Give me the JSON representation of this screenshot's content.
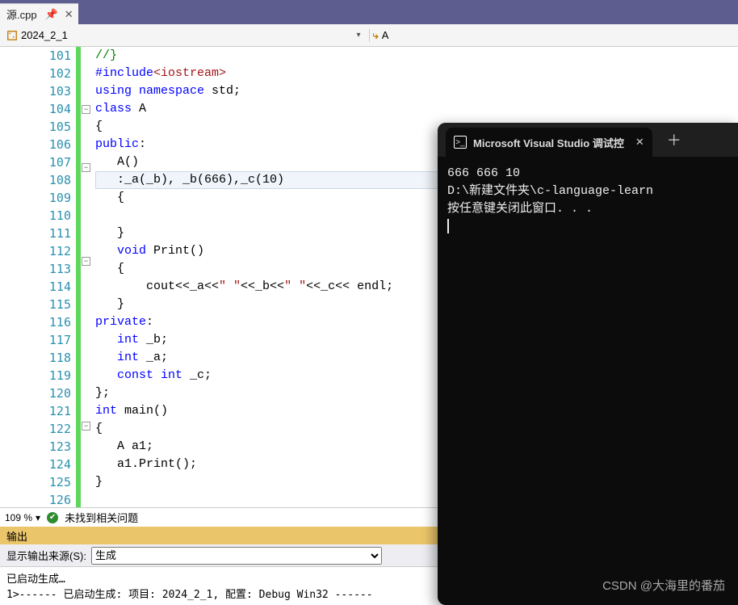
{
  "tab": {
    "label": "源.cpp"
  },
  "selectors": {
    "left": "2024_2_1",
    "right": "A"
  },
  "line_start": 101,
  "code_lines": [
    {
      "fold": "",
      "tokens": [
        {
          "t": "punct",
          "v": "|"
        },
        {
          "t": "comment",
          "v": "//}"
        }
      ]
    },
    {
      "fold": "",
      "tokens": [
        {
          "t": "punct",
          "v": "|"
        },
        {
          "t": "keyword",
          "v": "#include"
        },
        {
          "t": "lib",
          "v": "<iostream>"
        }
      ]
    },
    {
      "fold": "",
      "tokens": [
        {
          "t": "punct",
          "v": "|"
        },
        {
          "t": "keyword",
          "v": "using namespace"
        },
        {
          "t": "normal",
          "v": " std"
        },
        {
          "t": "semicl",
          "v": ";"
        }
      ]
    },
    {
      "fold": "⊟",
      "tokens": [
        {
          "t": "keyword",
          "v": "class"
        },
        {
          "t": "normal",
          "v": " A"
        }
      ]
    },
    {
      "fold": "",
      "tokens": [
        {
          "t": "punct",
          "v": "|{"
        }
      ]
    },
    {
      "fold": "",
      "tokens": [
        {
          "t": "punct",
          "v": "|"
        },
        {
          "t": "keyword",
          "v": "public"
        },
        {
          "t": "punct",
          "v": ":"
        }
      ]
    },
    {
      "fold": "⊟",
      "tokens": [
        {
          "t": "punct",
          "v": "|   "
        },
        {
          "t": "normal",
          "v": "A()"
        }
      ]
    },
    {
      "fold": "",
      "highlight": true,
      "tokens": [
        {
          "t": "punct",
          "v": "|   "
        },
        {
          "t": "normal",
          "v": ":_a(_b), _b(666),_c(10)"
        }
      ]
    },
    {
      "fold": "",
      "tokens": [
        {
          "t": "punct",
          "v": "|   {"
        }
      ]
    },
    {
      "fold": "",
      "tokens": [
        {
          "t": "punct",
          "v": "|"
        }
      ]
    },
    {
      "fold": "",
      "tokens": [
        {
          "t": "punct",
          "v": "|   }"
        }
      ]
    },
    {
      "fold": "⊟",
      "tokens": [
        {
          "t": "punct",
          "v": "|   "
        },
        {
          "t": "keyword",
          "v": "void"
        },
        {
          "t": "normal",
          "v": " Print()"
        }
      ]
    },
    {
      "fold": "",
      "tokens": [
        {
          "t": "punct",
          "v": "|   {"
        }
      ]
    },
    {
      "fold": "",
      "tokens": [
        {
          "t": "punct",
          "v": "|       "
        },
        {
          "t": "normal",
          "v": "cout<<_a<<"
        },
        {
          "t": "string",
          "v": "\" \""
        },
        {
          "t": "normal",
          "v": "<<_b<<"
        },
        {
          "t": "string",
          "v": "\" \""
        },
        {
          "t": "normal",
          "v": "<<_c<< endl"
        },
        {
          "t": "semicl",
          "v": ";"
        }
      ]
    },
    {
      "fold": "",
      "tokens": [
        {
          "t": "punct",
          "v": "|   }"
        }
      ]
    },
    {
      "fold": "",
      "tokens": [
        {
          "t": "punct",
          "v": "|"
        },
        {
          "t": "keyword",
          "v": "private"
        },
        {
          "t": "punct",
          "v": ":"
        }
      ]
    },
    {
      "fold": "",
      "tokens": [
        {
          "t": "punct",
          "v": "|   "
        },
        {
          "t": "keyword",
          "v": "int"
        },
        {
          "t": "normal",
          "v": " _b"
        },
        {
          "t": "semicl",
          "v": ";"
        }
      ]
    },
    {
      "fold": "",
      "tokens": [
        {
          "t": "punct",
          "v": "|   "
        },
        {
          "t": "keyword",
          "v": "int"
        },
        {
          "t": "normal",
          "v": " _a"
        },
        {
          "t": "semicl",
          "v": ";"
        }
      ]
    },
    {
      "fold": "",
      "tokens": [
        {
          "t": "punct",
          "v": "|   "
        },
        {
          "t": "keyword",
          "v": "const int"
        },
        {
          "t": "normal",
          "v": " _c"
        },
        {
          "t": "semicl",
          "v": ";"
        }
      ]
    },
    {
      "fold": "",
      "tokens": [
        {
          "t": "punct",
          "v": "|};"
        }
      ]
    },
    {
      "fold": "⊟",
      "tokens": [
        {
          "t": "keyword",
          "v": "int"
        },
        {
          "t": "normal",
          "v": " main()"
        }
      ]
    },
    {
      "fold": "",
      "tokens": [
        {
          "t": "punct",
          "v": "|{"
        }
      ]
    },
    {
      "fold": "",
      "tokens": [
        {
          "t": "punct",
          "v": "|   "
        },
        {
          "t": "normal",
          "v": "A a1"
        },
        {
          "t": "semicl",
          "v": ";"
        }
      ]
    },
    {
      "fold": "",
      "tokens": [
        {
          "t": "punct",
          "v": "|   "
        },
        {
          "t": "normal",
          "v": "a1.Print()"
        },
        {
          "t": "semicl",
          "v": ";"
        }
      ]
    },
    {
      "fold": "",
      "tokens": [
        {
          "t": "punct",
          "v": "|}"
        }
      ]
    },
    {
      "fold": "",
      "tokens": [
        {
          "t": "punct",
          "v": ""
        }
      ]
    }
  ],
  "status": {
    "zoom": "109 %",
    "issues": "未找到相关问题"
  },
  "output": {
    "title": "输出",
    "source_label": "显示输出来源(S):",
    "source_value": "生成",
    "lines": [
      "已启动生成…",
      "1>------ 已启动生成: 项目: 2024_2_1, 配置: Debug Win32 ------"
    ]
  },
  "terminal": {
    "tab_title": "Microsoft Visual Studio 调试控",
    "lines": [
      "666 666 10",
      "",
      "D:\\新建文件夹\\c-language-learn",
      "按任意键关闭此窗口. . ."
    ]
  },
  "watermark": "CSDN @大海里的番茄"
}
